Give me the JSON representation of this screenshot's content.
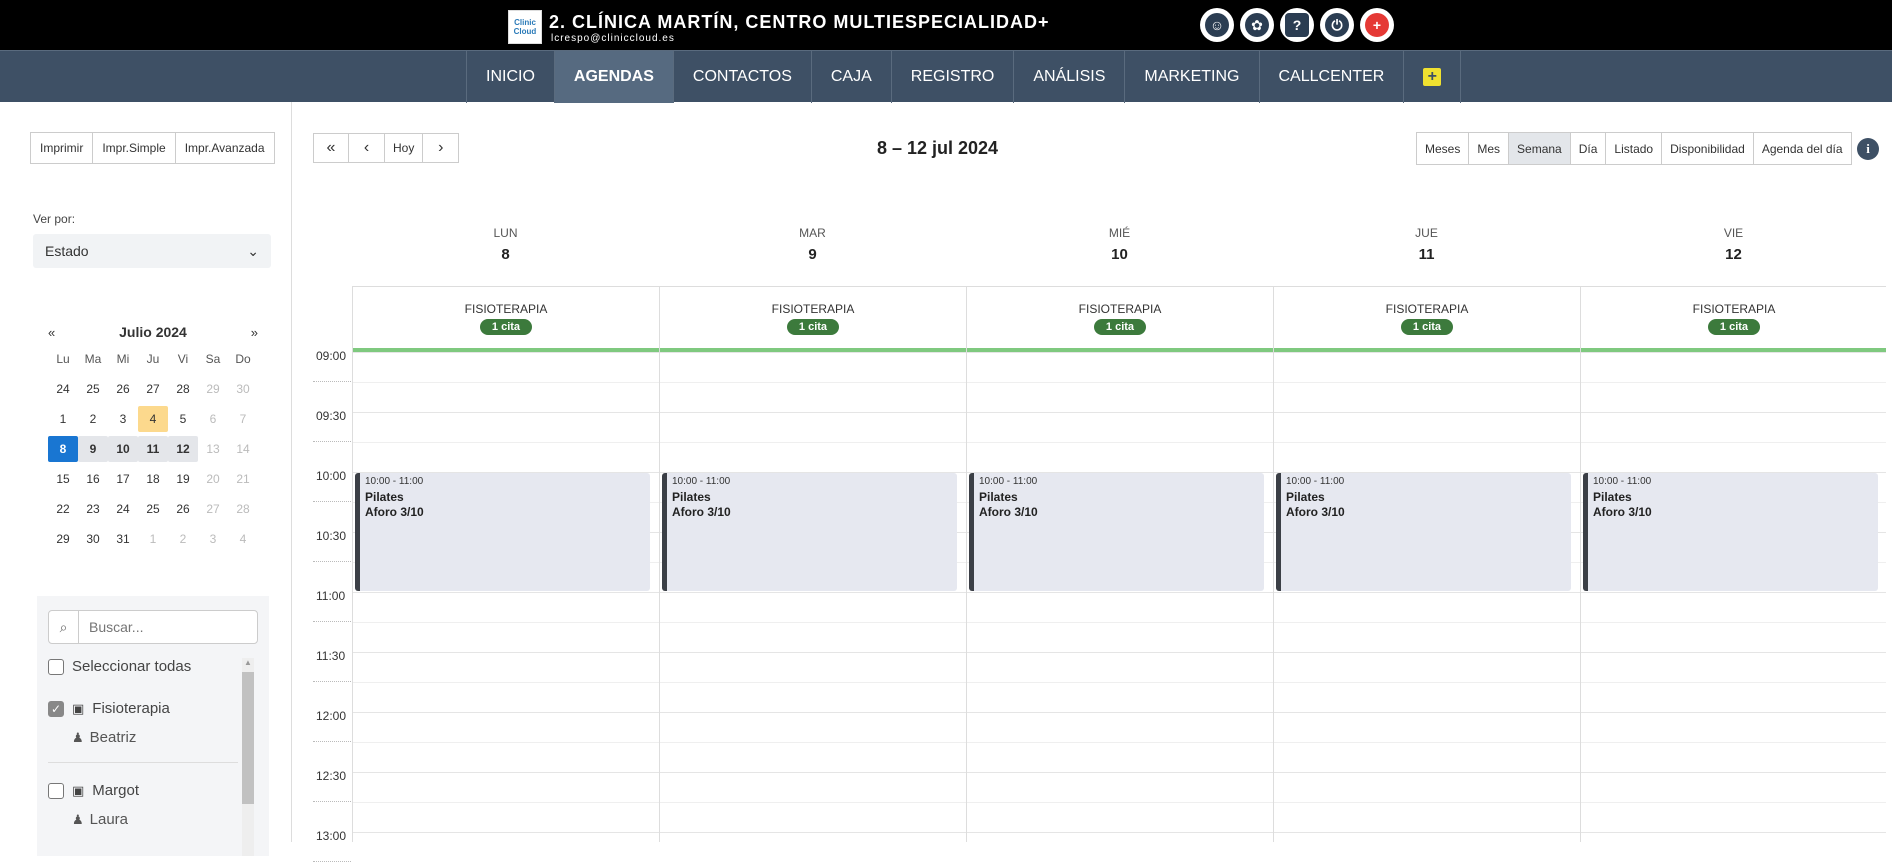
{
  "header": {
    "logo_text": [
      "Clinic",
      "Cloud"
    ],
    "title": "2. CLÍNICA MARTÍN, CENTRO MULTIESPECIALIDAD+",
    "user": "lcrespo@cliniccloud.es",
    "icons": [
      "face-icon",
      "gear-icon",
      "help-icon",
      "power-icon",
      "alarm-icon"
    ]
  },
  "nav": {
    "items": [
      "INICIO",
      "AGENDAS",
      "CONTACTOS",
      "CAJA",
      "REGISTRO",
      "ANÁLISIS",
      "MARKETING",
      "CALLCENTER"
    ],
    "active": "AGENDAS",
    "plus": "+"
  },
  "sidebar": {
    "print_buttons": [
      "Imprimir",
      "Impr.Simple",
      "Impr.Avanzada"
    ],
    "ver_por_label": "Ver por:",
    "ver_por_value": "Estado",
    "minical": {
      "prev": "«",
      "next": "»",
      "title": "Julio 2024",
      "dow": [
        "Lu",
        "Ma",
        "Mi",
        "Ju",
        "Vi",
        "Sa",
        "Do"
      ],
      "weeks": [
        [
          "24",
          "25",
          "26",
          "27",
          "28",
          "29",
          "30"
        ],
        [
          "1",
          "2",
          "3",
          "4",
          "5",
          "6",
          "7"
        ],
        [
          "8",
          "9",
          "10",
          "11",
          "12",
          "13",
          "14"
        ],
        [
          "15",
          "16",
          "17",
          "18",
          "19",
          "20",
          "21"
        ],
        [
          "22",
          "23",
          "24",
          "25",
          "26",
          "27",
          "28"
        ],
        [
          "29",
          "30",
          "31",
          "1",
          "2",
          "3",
          "4"
        ]
      ],
      "today": "4",
      "selected": "8"
    },
    "search_placeholder": "Buscar...",
    "select_all": "Seleccionar todas",
    "groups": [
      {
        "name": "Fisioterapia",
        "checked": true,
        "member": "Beatriz"
      },
      {
        "name": "Margot",
        "checked": false,
        "member": "Laura"
      }
    ]
  },
  "calendar": {
    "toolbar": {
      "first": "«",
      "prev": "‹",
      "today": "Hoy",
      "next": "›"
    },
    "range": "8 – 12 jul 2024",
    "views": [
      "Meses",
      "Mes",
      "Semana",
      "Día",
      "Listado",
      "Disponibilidad",
      "Agenda del día"
    ],
    "active_view": "Semana",
    "info": "i",
    "days": [
      {
        "dow": "LUN",
        "num": "8"
      },
      {
        "dow": "MAR",
        "num": "9"
      },
      {
        "dow": "MIÉ",
        "num": "10"
      },
      {
        "dow": "JUE",
        "num": "11"
      },
      {
        "dow": "VIE",
        "num": "12"
      }
    ],
    "resource": "FISIOTERAPIA",
    "resource_badge": "1 cita",
    "times": [
      "09:00",
      "09:30",
      "10:00",
      "10:30",
      "11:00",
      "11:30",
      "12:00",
      "12:30",
      "13:00"
    ],
    "event": {
      "time": "10:00 - 11:00",
      "title": "Pilates",
      "sub": "Aforo 3/10"
    }
  }
}
